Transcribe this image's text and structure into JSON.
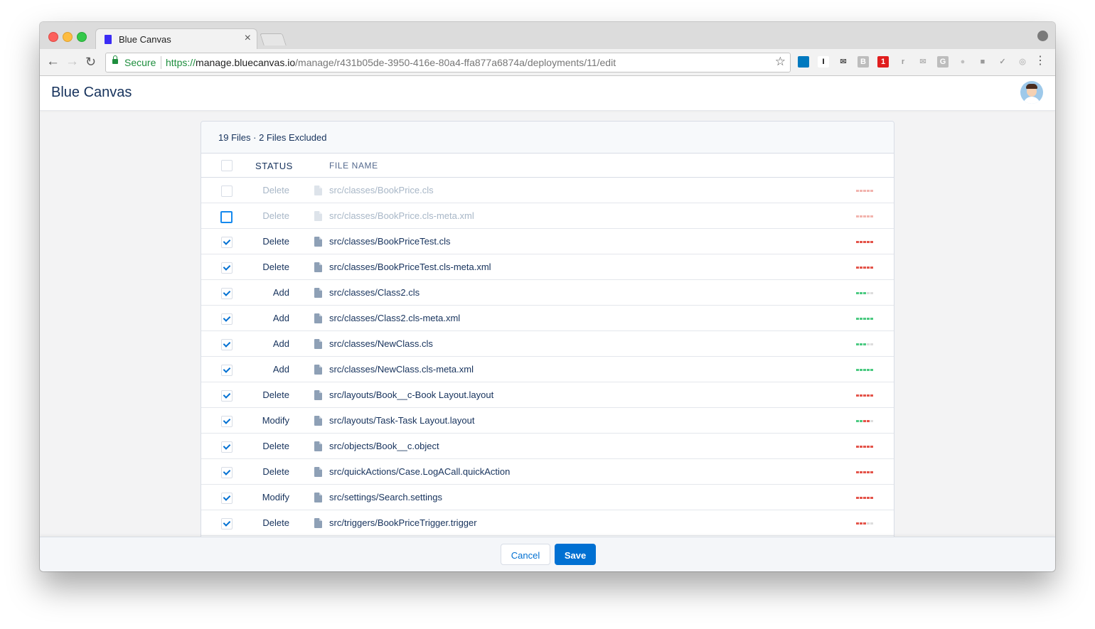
{
  "browser": {
    "tab_title": "Blue Canvas",
    "tab_close": "×",
    "secure_label": "Secure",
    "url_scheme": "https://",
    "url_host": "manage.bluecanvas.io",
    "url_path": "/manage/r431b05de-3950-416e-80a4-ffa877a6874a/deployments/11/edit",
    "extensions": [
      {
        "name": "trello-icon",
        "glyph": "",
        "bg": "#0079bf",
        "fg": "#ffffff"
      },
      {
        "name": "instapaper-icon",
        "glyph": "I",
        "bg": "#ffffff",
        "fg": "#000000"
      },
      {
        "name": "mail-icon",
        "glyph": "✉",
        "bg": "#f2f2f2",
        "fg": "#555555"
      },
      {
        "name": "b-extension-icon",
        "glyph": "B",
        "bg": "#bdbdbd",
        "fg": "#ffffff"
      },
      {
        "name": "calendar-badge-icon",
        "glyph": "1",
        "bg": "#e01e1e",
        "fg": "#ffffff"
      },
      {
        "name": "r-extension-icon",
        "glyph": "r",
        "bg": "#f2f2f2",
        "fg": "#9a9a9a"
      },
      {
        "name": "envelope-icon",
        "glyph": "✉",
        "bg": "#f2f2f2",
        "fg": "#b5b5b5"
      },
      {
        "name": "g-extension-icon",
        "glyph": "G",
        "bg": "#bdbdbd",
        "fg": "#ffffff"
      },
      {
        "name": "dot-extension-icon",
        "glyph": "●",
        "bg": "#f2f2f2",
        "fg": "#c0c0c0"
      },
      {
        "name": "square-extension-icon",
        "glyph": "■",
        "bg": "#f2f2f2",
        "fg": "#9a9a9a"
      },
      {
        "name": "check-extension-icon",
        "glyph": "✓",
        "bg": "#f2f2f2",
        "fg": "#9a9a9a"
      },
      {
        "name": "circle-extension-icon",
        "glyph": "◎",
        "bg": "#f2f2f2",
        "fg": "#c0c0c0"
      }
    ]
  },
  "app": {
    "brand": "Blue Canvas"
  },
  "files": {
    "summary": "19 Files · 2 Files Excluded",
    "columns": {
      "status": "STATUS",
      "filename": "FILE NAME"
    },
    "rows": [
      {
        "status": "Delete",
        "path": "src/classes/BookPrice.cls",
        "checked": false,
        "excluded": true,
        "diff": [
          "d",
          "d",
          "d",
          "d",
          "d"
        ]
      },
      {
        "status": "Delete",
        "path": "src/classes/BookPrice.cls-meta.xml",
        "checked": false,
        "excluded": true,
        "focused": true,
        "diff": [
          "d",
          "d",
          "d",
          "d",
          "d"
        ]
      },
      {
        "status": "Delete",
        "path": "src/classes/BookPriceTest.cls",
        "checked": true,
        "diff": [
          "d",
          "d",
          "d",
          "d",
          "d"
        ]
      },
      {
        "status": "Delete",
        "path": "src/classes/BookPriceTest.cls-meta.xml",
        "checked": true,
        "diff": [
          "d",
          "d",
          "d",
          "d",
          "d"
        ]
      },
      {
        "status": "Add",
        "path": "src/classes/Class2.cls",
        "checked": true,
        "diff": [
          "a",
          "a",
          "a",
          "n",
          "n"
        ]
      },
      {
        "status": "Add",
        "path": "src/classes/Class2.cls-meta.xml",
        "checked": true,
        "diff": [
          "a",
          "a",
          "a",
          "a",
          "a"
        ]
      },
      {
        "status": "Add",
        "path": "src/classes/NewClass.cls",
        "checked": true,
        "diff": [
          "a",
          "a",
          "a",
          "n",
          "n"
        ]
      },
      {
        "status": "Add",
        "path": "src/classes/NewClass.cls-meta.xml",
        "checked": true,
        "diff": [
          "a",
          "a",
          "a",
          "a",
          "a"
        ]
      },
      {
        "status": "Delete",
        "path": "src/layouts/Book__c-Book Layout.layout",
        "checked": true,
        "diff": [
          "d",
          "d",
          "d",
          "d",
          "d"
        ]
      },
      {
        "status": "Modify",
        "path": "src/layouts/Task-Task Layout.layout",
        "checked": true,
        "diff": [
          "a",
          "a",
          "d",
          "d",
          "n"
        ]
      },
      {
        "status": "Delete",
        "path": "src/objects/Book__c.object",
        "checked": true,
        "diff": [
          "d",
          "d",
          "d",
          "d",
          "d"
        ]
      },
      {
        "status": "Delete",
        "path": "src/quickActions/Case.LogACall.quickAction",
        "checked": true,
        "diff": [
          "d",
          "d",
          "d",
          "d",
          "d"
        ]
      },
      {
        "status": "Modify",
        "path": "src/settings/Search.settings",
        "checked": true,
        "diff": [
          "d",
          "d",
          "d",
          "d",
          "d"
        ]
      },
      {
        "status": "Delete",
        "path": "src/triggers/BookPriceTrigger.trigger",
        "checked": true,
        "diff": [
          "d",
          "d",
          "d",
          "n",
          "n"
        ]
      }
    ]
  },
  "footer": {
    "cancel_label": "Cancel",
    "save_label": "Save"
  },
  "colors": {
    "diff_add": "#4bca81",
    "diff_delete": "#e4544a",
    "diff_none": "#dddddd",
    "diff_delete_faded": "#f2b4ae",
    "primary": "#0070d2"
  }
}
